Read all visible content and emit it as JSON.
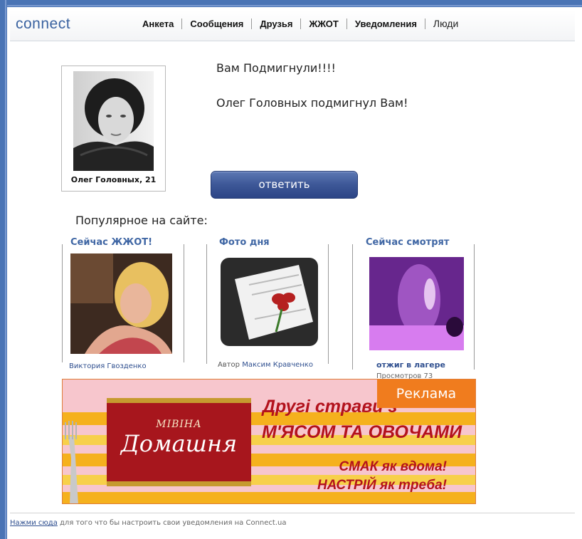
{
  "header": {
    "logo": "connect",
    "nav": [
      "Анкета",
      "Сообщения",
      "Друзья",
      "ЖЖОТ",
      "Уведомления",
      "Люди"
    ]
  },
  "profile": {
    "name": "Олег Головных, 21"
  },
  "notification": {
    "title": "Вам Подмигнули!!!!",
    "message": "Олег Головных подмигнул Вам!",
    "reply_button": "ответить"
  },
  "popular": {
    "heading": "Популярное на сайте:",
    "blocks": [
      {
        "title": "Сейчас ЖЖОТ!",
        "caption": "Виктория Гвозденко"
      },
      {
        "title": "Фото дня",
        "caption_prefix": "Автор",
        "caption_author": "Максим Кравченко"
      },
      {
        "title": "Сейчас смотрят",
        "caption_title": "отжиг в лагере",
        "caption_views": "Просмотров 73"
      }
    ]
  },
  "ad": {
    "badge": "Реклама",
    "brand_top": "МІВІНА",
    "brand_main": "Домашня",
    "line1": "Другі страви з",
    "line2": "М'ЯСОМ ТА ОВОЧАМИ",
    "line3": "СМАК як вдома!",
    "line4": "НАСТРІЙ як треба!"
  },
  "footer": {
    "link": "Нажми сюда",
    "text": " для того что бы настроить свои уведомления на Connect.ua"
  }
}
